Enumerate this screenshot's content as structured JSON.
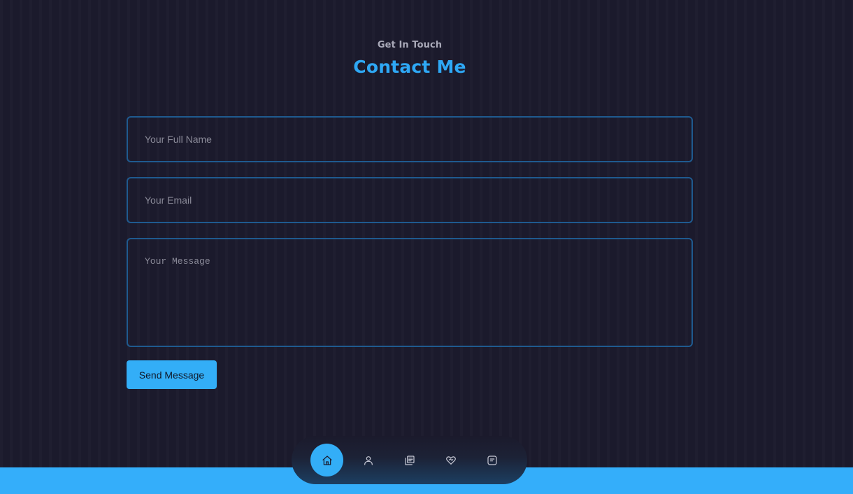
{
  "header": {
    "eyebrow": "Get In Touch",
    "title": "Contact Me"
  },
  "form": {
    "name_placeholder": "Your Full Name",
    "email_placeholder": "Your Email",
    "message_placeholder": "Your Message",
    "submit_label": "Send Message"
  },
  "dock": {
    "items": [
      {
        "icon": "home-icon",
        "active": true
      },
      {
        "icon": "user-icon",
        "active": false
      },
      {
        "icon": "book-icon",
        "active": false
      },
      {
        "icon": "handshake-icon",
        "active": false
      },
      {
        "icon": "message-icon",
        "active": false
      }
    ]
  },
  "colors": {
    "background": "#1b1a2c",
    "accent": "#33aef7",
    "input_border": "#1f5a8f",
    "title": "#2ea8f5"
  }
}
